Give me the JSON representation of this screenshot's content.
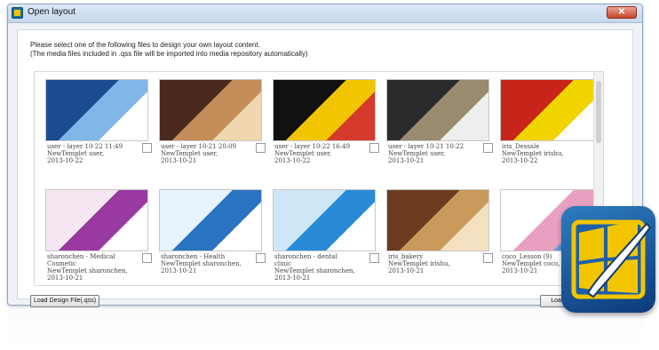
{
  "window": {
    "title": "Open layout",
    "close_glyph": "✕"
  },
  "instructions": {
    "line1": "Please select one of the following files to design your own layout content.",
    "line2": "(The media files included in .qss file will be imported into media repository automatically)"
  },
  "thumbnails": [
    {
      "row": 0,
      "col": 0,
      "thumb": "city-harbor",
      "caption": "user - layer 10-22 11:49\nNewTemplet user,\n2013-10-22"
    },
    {
      "row": 0,
      "col": 1,
      "thumb": "restaurant",
      "caption": "user - layer 10-21 20:09\nNewTemplet user,\n2013-10-21"
    },
    {
      "row": 0,
      "col": 2,
      "thumb": "food-display",
      "caption": "user - layer 10-22 16:49\nNewTemplet user,\n2013-10-22"
    },
    {
      "row": 0,
      "col": 3,
      "thumb": "hotel-room",
      "caption": "user - layer 10-21 10:22\nNewTemplet user,\n2013-10-21"
    },
    {
      "row": 0,
      "col": 4,
      "thumb": "sale-red",
      "caption": "iris_Dessale\nNewTemplet irishu,\n2013-10-22"
    },
    {
      "row": 1,
      "col": 0,
      "thumb": "medical-cosmetic",
      "caption": "sharonchen - Medical\nCosmetic\nNewTemplet sharonchen,\n2013-10-21"
    },
    {
      "row": 1,
      "col": 1,
      "thumb": "health",
      "caption": "sharonchen - Health\nNewTemplet sharonchen,\n2013-10-21"
    },
    {
      "row": 1,
      "col": 2,
      "thumb": "dental-clinic",
      "caption": "sharonchen - dental\nclinic\nNewTemplet sharonchen,\n2013-10-21"
    },
    {
      "row": 1,
      "col": 3,
      "thumb": "bakery",
      "caption": "iris_bakery\nNewTemplet irishu,\n2013-10-21"
    },
    {
      "row": 1,
      "col": 4,
      "thumb": "coco-lesson",
      "caption": "coco_Lesson (9)\nNewTemplet coco,\n2013-10-21"
    }
  ],
  "buttons": {
    "load_design_file": "Load Design File(.qss)",
    "load": "Load"
  },
  "badge": {
    "icon": "window-paintbrush-icon"
  },
  "colors": {
    "title_bar": "#c5d7ec",
    "close_button": "#c5452b",
    "badge_blue": "#1e5fa8",
    "badge_yellow": "#f2c500"
  }
}
